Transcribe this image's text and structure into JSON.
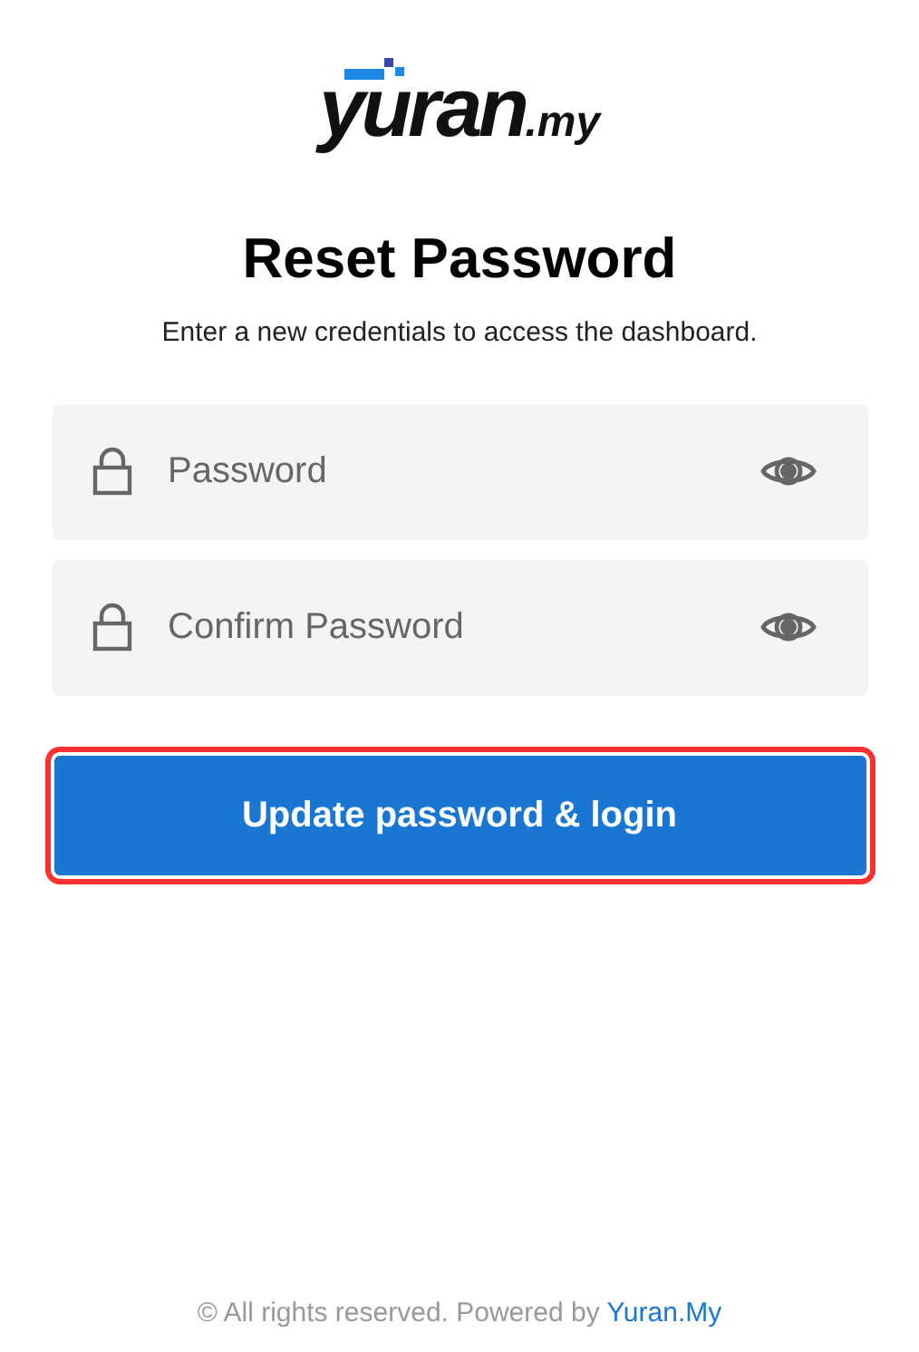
{
  "logo": {
    "name": "yuran",
    "suffix": ".my"
  },
  "title": "Reset Password",
  "subtitle": "Enter a new credentials to access the dashboard.",
  "fields": [
    {
      "placeholder": "Password"
    },
    {
      "placeholder": "Confirm Password"
    }
  ],
  "submit_button": {
    "label": "Update password & login",
    "focused": true
  },
  "footer": {
    "text": "© All rights reserved. Powered by",
    "link": "Yuran.My"
  }
}
